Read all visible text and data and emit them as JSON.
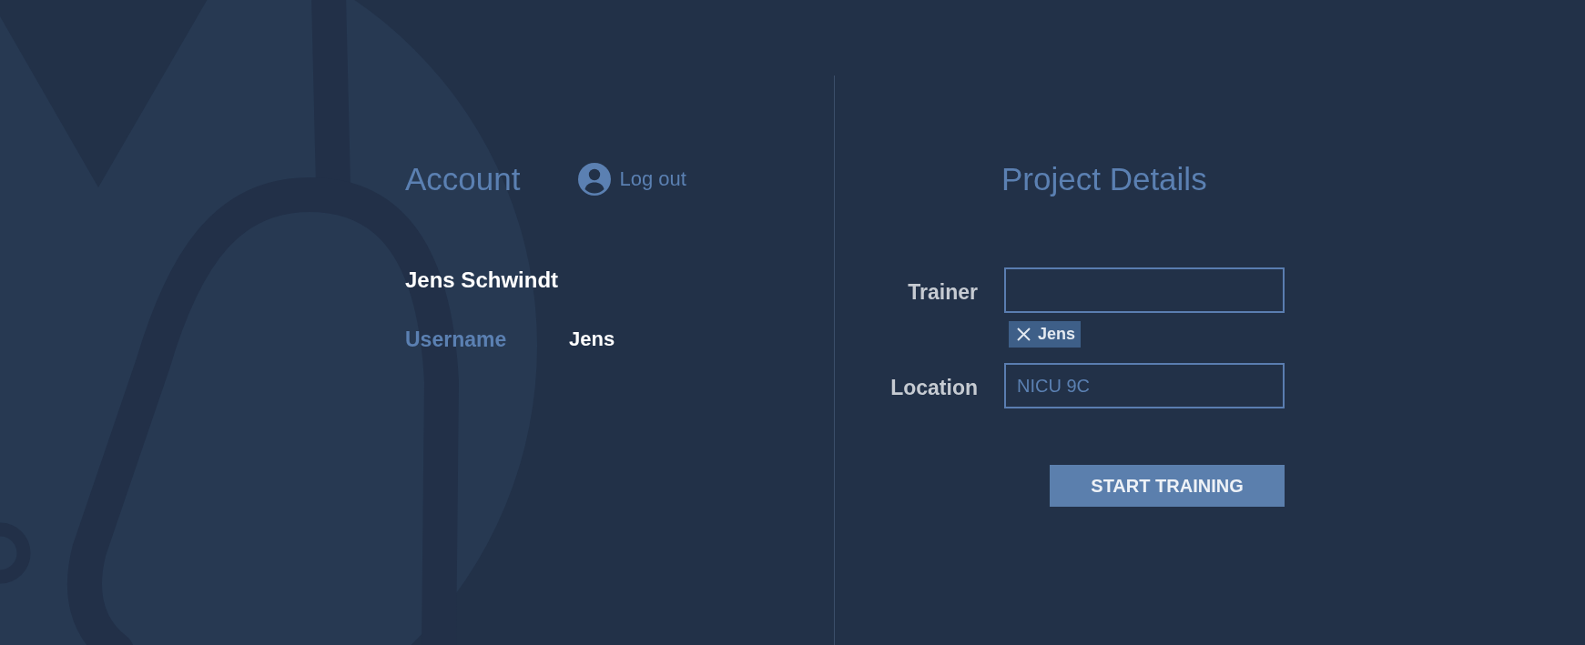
{
  "account": {
    "title": "Account",
    "logout": "Log out",
    "full_name": "Jens Schwindt",
    "details": [
      {
        "label": "Username",
        "value": "Jens"
      }
    ]
  },
  "project_details": {
    "title": "Project Details",
    "fields": [
      {
        "kind": "tags",
        "label": "Trainer",
        "tags": [
          "Jens"
        ]
      },
      {
        "kind": "text",
        "label": "Location",
        "placeholder": "NICU 9C"
      }
    ],
    "submit": "START TRAINING"
  }
}
